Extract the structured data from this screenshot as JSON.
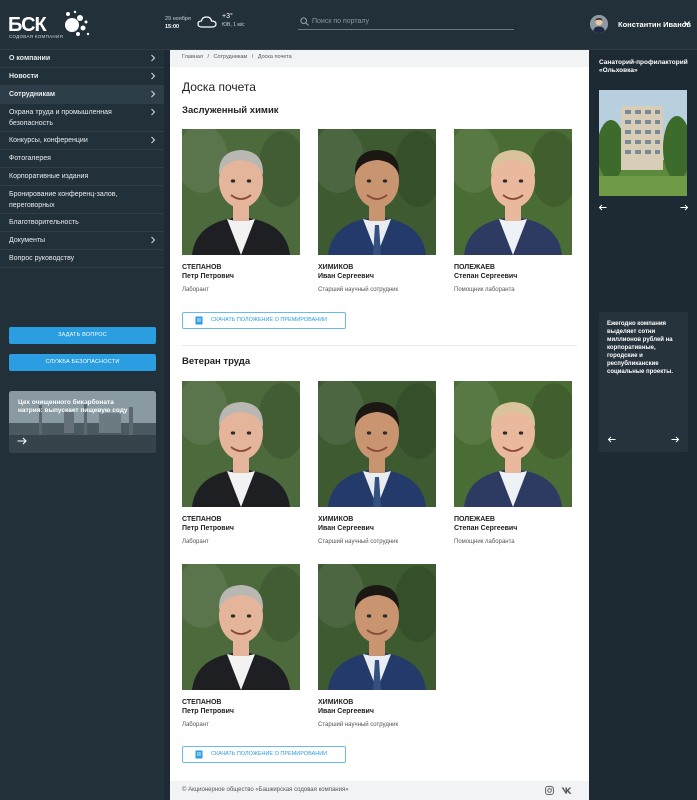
{
  "header": {
    "logo_text": "БСК",
    "logo_sub": "СОДОВАЯ КОМПАНИЯ",
    "date": "29 ноября",
    "time": "15:00",
    "temperature": "+3°",
    "wind": "ЮВ, 1 м/с",
    "search_placeholder": "Поиск по порталу",
    "user_name": "Константин Иванов"
  },
  "sidebar": {
    "items": [
      {
        "label": "О компании",
        "bold": true,
        "chevron": true
      },
      {
        "label": "Новости",
        "bold": true,
        "chevron": true
      },
      {
        "label": "Сотрудникам",
        "bold": true,
        "chevron": true,
        "active": true
      },
      {
        "label": "Охрана труда и промышленная безопасность",
        "chevron": true,
        "tall": true
      },
      {
        "label": "Конкурсы, конференции",
        "chevron": true
      },
      {
        "label": "Фотогалерея"
      },
      {
        "label": "Корпоративные издания"
      },
      {
        "label": "Бронирование конференц-залов, переговорных",
        "tall": true
      },
      {
        "label": "Благотворительность"
      },
      {
        "label": "Документы",
        "chevron": true
      },
      {
        "label": "Вопрос руководству"
      }
    ],
    "ask_button": "Задать вопрос",
    "security_button": "Служба безопасности",
    "promo_text": "Цех очищенного бикарбоната натрия: выпускает пищевую соду"
  },
  "breadcrumb": [
    "Главная",
    "/",
    "Сотрудникам",
    "/",
    "Доска почета"
  ],
  "page_title": "Доска почета",
  "sections": [
    {
      "title": "Заслуженный химик",
      "people": [
        {
          "surname": "СТЕПАНОВ",
          "name": "Петр Петрович",
          "role": "Лаборант"
        },
        {
          "surname": "ХИМИКОВ",
          "name": "Иван Сергеевич",
          "role": "Старший научный сотрудник"
        },
        {
          "surname": "ПОЛЕЖАЕВ",
          "name": "Степан Сергеевич",
          "role": "Помощник лаборанта"
        }
      ],
      "download": "Скачать положение о премировании"
    },
    {
      "title": "Ветеран труда",
      "people": [
        {
          "surname": "СТЕПАНОВ",
          "name": "Петр Петрович",
          "role": "Лаборант"
        },
        {
          "surname": "ХИМИКОВ",
          "name": "Иван Сергеевич",
          "role": "Старший научный сотрудник"
        },
        {
          "surname": "ПОЛЕЖАЕВ",
          "name": "Степан Сергеевич",
          "role": "Помощник лаборанта"
        },
        {
          "surname": "СТЕПАНОВ",
          "name": "Петр Петрович",
          "role": "Лаборант"
        },
        {
          "surname": "ХИМИКОВ",
          "name": "Иван Сергеевич",
          "role": "Старший научный сотрудник"
        }
      ],
      "download": "Скачать положение о премировании"
    }
  ],
  "footer": {
    "copyright": "© Акционерное общество «Башкирская содовая компания»"
  },
  "right": {
    "sanatorium_title": "Санаторий-профилакторий «Ольховка»",
    "info_text": "Ежегодно компания выделяет сотни миллионов рублей на корпоративные, городские и республиканские социальные проекты."
  },
  "colors": {
    "accent": "#2a9ee0",
    "dark_bg": "#223039",
    "body_bg": "#1d2a34"
  }
}
